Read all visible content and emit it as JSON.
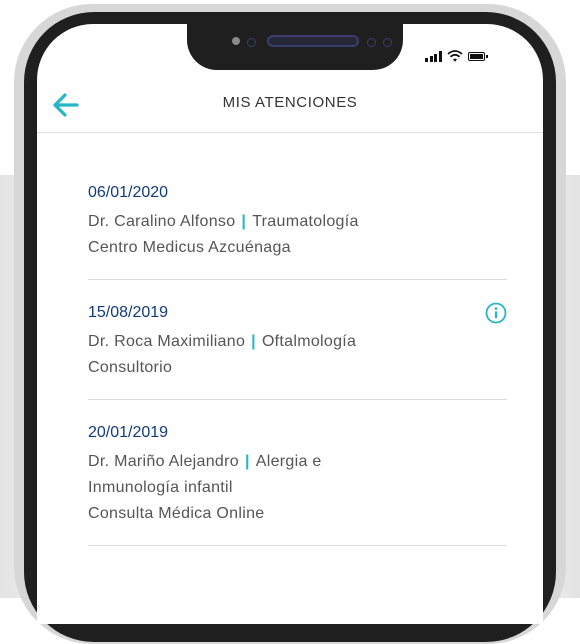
{
  "header": {
    "title": "MIS ATENCIONES",
    "back_icon": "arrow-left-icon"
  },
  "colors": {
    "accent": "#27b5c8",
    "date": "#123a7a",
    "text": "#555555",
    "frame": "#1f1f1f"
  },
  "status_bar": {
    "icons": [
      "signal-icon",
      "wifi-icon",
      "battery-icon"
    ]
  },
  "appointments": [
    {
      "date": "06/01/2020",
      "doctor": "Dr. Caralino Alfonso",
      "specialty": "Traumatología",
      "place": "Centro Medicus Azcuénaga",
      "separator": "|"
    },
    {
      "date": "15/08/2019",
      "doctor": "Dr. Roca Maximiliano",
      "specialty": "Oftalmología",
      "place": "Consultorio",
      "separator": "|",
      "info_icon": "info-icon"
    },
    {
      "date": "20/01/2019",
      "doctor": "Dr. Mariño Alejandro",
      "specialty": "Alergia e",
      "specialty_cont": "Inmunología infantil",
      "place": "Consulta Médica Online",
      "separator": "|"
    }
  ]
}
